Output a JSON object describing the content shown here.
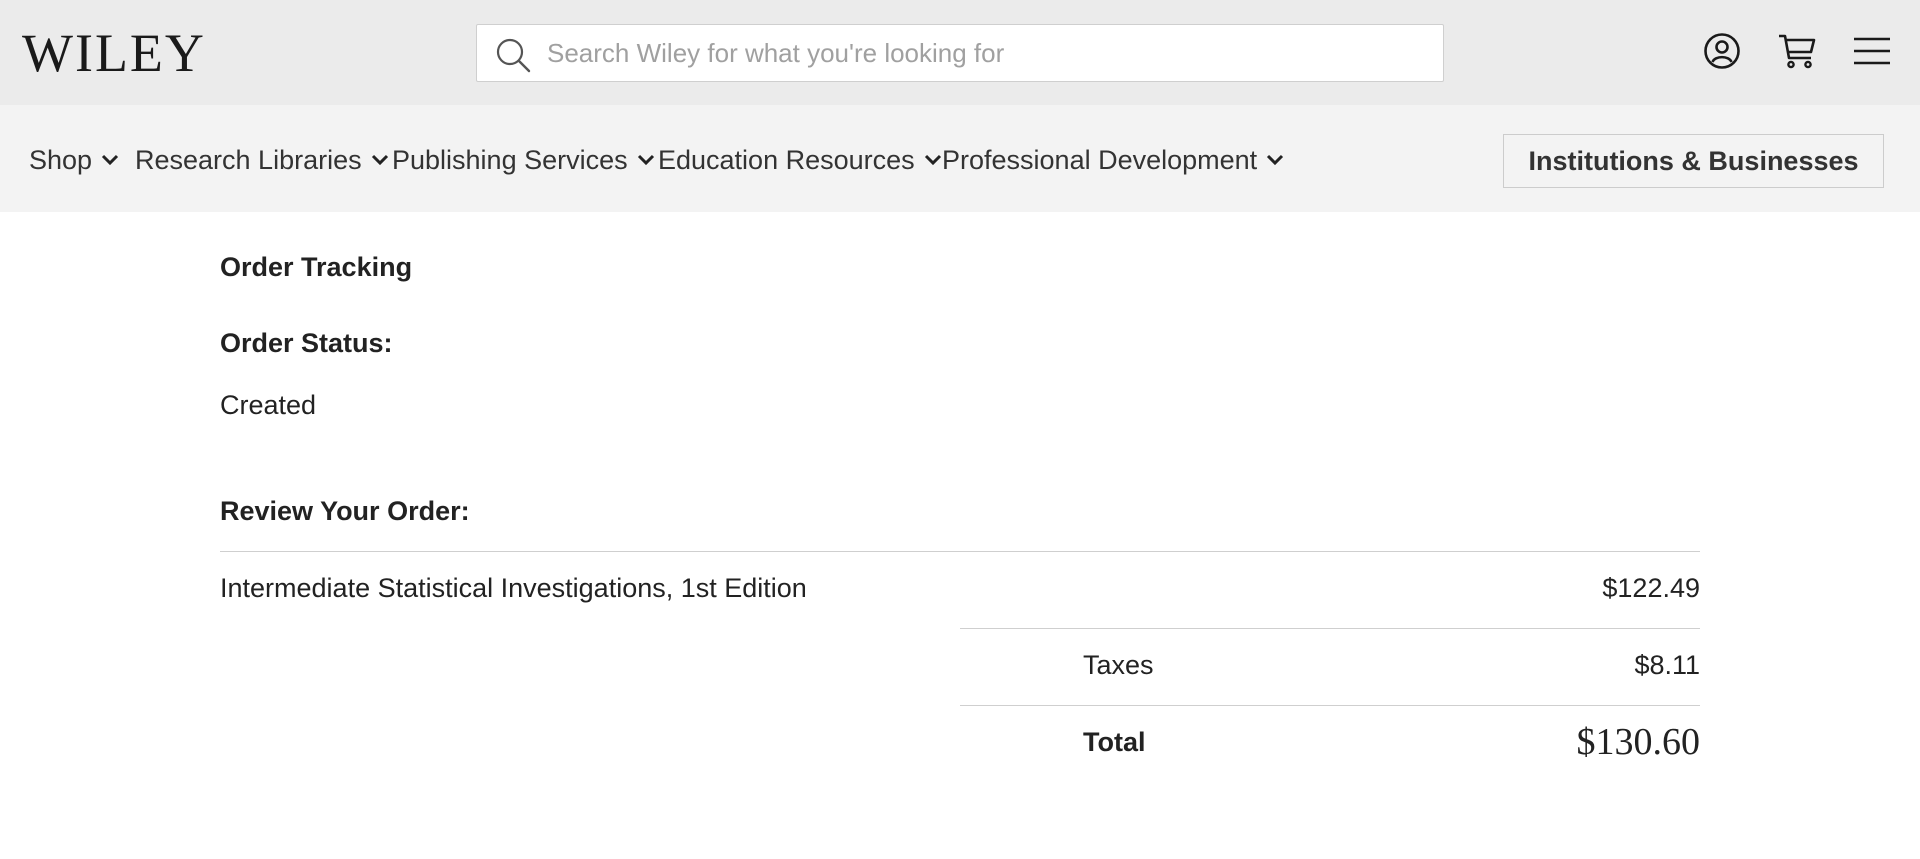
{
  "header": {
    "logo_text": "WILEY",
    "search": {
      "placeholder": "Search Wiley for what you're looking for",
      "value": ""
    },
    "icons": [
      "account-icon",
      "cart-icon",
      "menu-icon"
    ]
  },
  "nav": {
    "items": [
      {
        "label": "Shop"
      },
      {
        "label": "Research Libraries"
      },
      {
        "label": "Publishing Services"
      },
      {
        "label": "Education Resources"
      },
      {
        "label": "Professional Development"
      }
    ],
    "institutions_button": "Institutions & Businesses"
  },
  "order": {
    "title": "Order Tracking",
    "status_label": "Order Status:",
    "status_value": "Created",
    "review_label": "Review Your Order:",
    "items": [
      {
        "name": "Intermediate Statistical Investigations, 1st Edition",
        "price": "$122.49"
      }
    ],
    "taxes_label": "Taxes",
    "taxes_value": "$8.11",
    "total_label": "Total",
    "total_value": "$130.60"
  }
}
